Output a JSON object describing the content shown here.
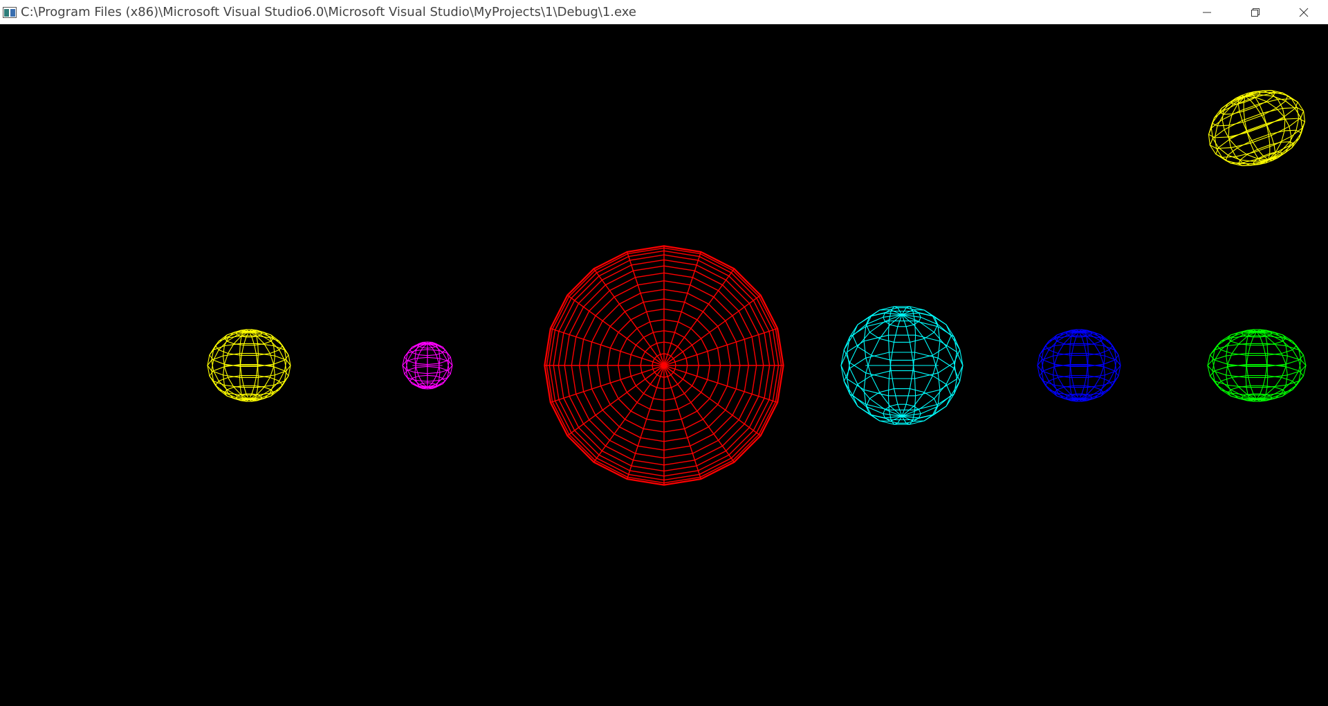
{
  "window": {
    "title": "C:\\Program Files (x86)\\Microsoft Visual Studio6.0\\Microsoft Visual Studio\\MyProjects\\1\\Debug\\1.exe",
    "background": "#000000",
    "titlebar_background": "#ffffff"
  },
  "icons": {
    "app": "console-app-icon",
    "minimize": "minimize-icon",
    "restore": "restore-icon",
    "close": "close-icon"
  },
  "scene": {
    "objects": [
      {
        "name": "sun",
        "color": "#ff0000",
        "description": "wireframe sphere viewed from pole"
      },
      {
        "name": "planet-1",
        "color": "#ffff00"
      },
      {
        "name": "planet-2",
        "color": "#ff00ff"
      },
      {
        "name": "planet-3",
        "color": "#00ffff"
      },
      {
        "name": "planet-4",
        "color": "#0000ff"
      },
      {
        "name": "planet-5",
        "color": "#00ff00"
      },
      {
        "name": "planet-6",
        "color": "#ffff00"
      }
    ]
  }
}
